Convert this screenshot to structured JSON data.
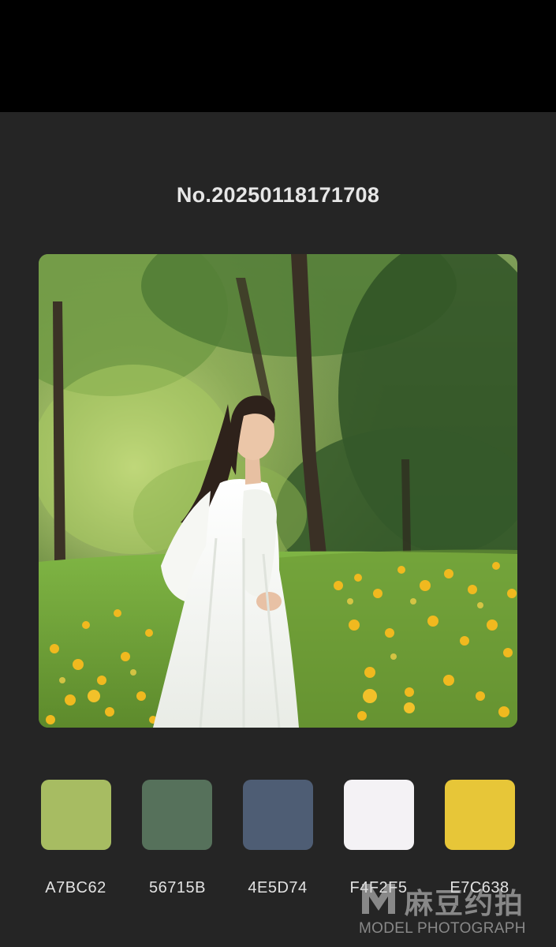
{
  "card": {
    "title": "No.20250118171708"
  },
  "photo": {
    "subject": "woman in white dress in a sunlit park meadow with yellow flowers"
  },
  "palette": [
    {
      "hex": "A7BC62",
      "color": "#A7BC62"
    },
    {
      "hex": "56715B",
      "color": "#56715B"
    },
    {
      "hex": "4E5D74",
      "color": "#4E5D74"
    },
    {
      "hex": "F4F2F5",
      "color": "#F4F2F5"
    },
    {
      "hex": "E7C638",
      "color": "#E7C638"
    }
  ],
  "watermark": {
    "logo_icon": "m-logo-icon",
    "chinese_text": "麻豆约拍",
    "english_text": "MODEL PHOTOGRAPH"
  }
}
